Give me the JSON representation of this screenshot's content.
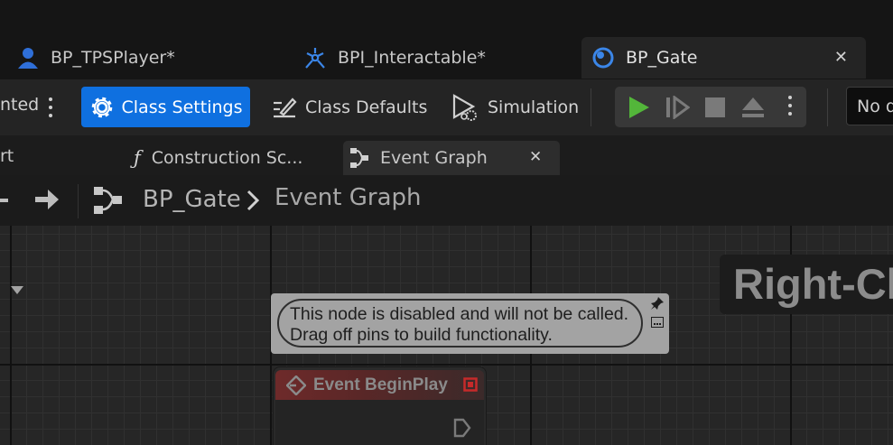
{
  "doc_tabs": [
    {
      "label": "BP_TPSPlayer*",
      "icon": "blueprint-pawn-icon"
    },
    {
      "label": "BPI_Interactable*",
      "icon": "blueprint-interface-icon"
    },
    {
      "label": "BP_Gate",
      "icon": "blueprint-actor-icon",
      "active": true
    }
  ],
  "toolbar": {
    "truncated_label": "nted",
    "class_settings": "Class Settings",
    "class_defaults": "Class Defaults",
    "simulation": "Simulation",
    "debug_filter": "No d"
  },
  "graph_tabs": {
    "truncated_label": "rt",
    "construction": "Construction Sc...",
    "event_graph": "Event Graph"
  },
  "breadcrumb": {
    "root": "BP_Gate",
    "current": "Event Graph"
  },
  "graph": {
    "watermark": "Right-Clic",
    "comment_line1": "This node is disabled and will not be called.",
    "comment_line2": "Drag off pins to build functionality.",
    "node_title": "Event BeginPlay"
  },
  "colors": {
    "accent": "#0f70e0",
    "play_green": "#53b63a",
    "event_red": "#c62a2a"
  }
}
